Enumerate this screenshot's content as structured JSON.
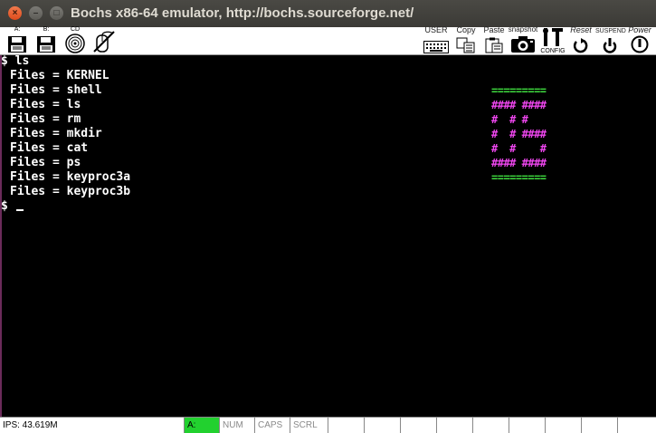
{
  "window": {
    "title": "Bochs x86-64 emulator, http://bochs.sourceforge.net/",
    "close_glyph": "×",
    "min_glyph": "–",
    "max_glyph": "□"
  },
  "toolbar": {
    "drive_a_label": "A:",
    "drive_b_label": "B:",
    "cdrom_label": "CD",
    "mouse_label": "",
    "user_label": "USER",
    "copy_label": "Copy",
    "paste_label": "Paste",
    "snapshot_label": "snapshot",
    "config_label": "CONFIG",
    "reset_label": "Reset",
    "suspend_label": "SUSPEND",
    "power_label": "Power"
  },
  "terminal": {
    "prompt_command": "$ ls",
    "lines": [
      "Files = KERNEL",
      "Files = shell",
      "Files = ls",
      "Files = rm",
      "Files = mkdir",
      "Files = cat",
      "Files = ps",
      "Files = keyproc3a",
      "Files = keyproc3b"
    ],
    "prompt": "$ ",
    "art": [
      {
        "text": "=========",
        "color": "#3fdc3f"
      },
      {
        "text": "#### ####",
        "color": "#ef46ef"
      },
      {
        "text": "#  # #",
        "color": "#ef46ef"
      },
      {
        "text": "#  # ####",
        "color": "#ef46ef"
      },
      {
        "text": "#  #    #",
        "color": "#ef46ef"
      },
      {
        "text": "#### ####",
        "color": "#ef46ef"
      },
      {
        "text": "=========",
        "color": "#3fdc3f"
      }
    ]
  },
  "statusbar": {
    "ips": "IPS: 43.619M",
    "drive_a": "A:",
    "num": "NUM",
    "caps": "CAPS",
    "scrl": "SCRL"
  }
}
